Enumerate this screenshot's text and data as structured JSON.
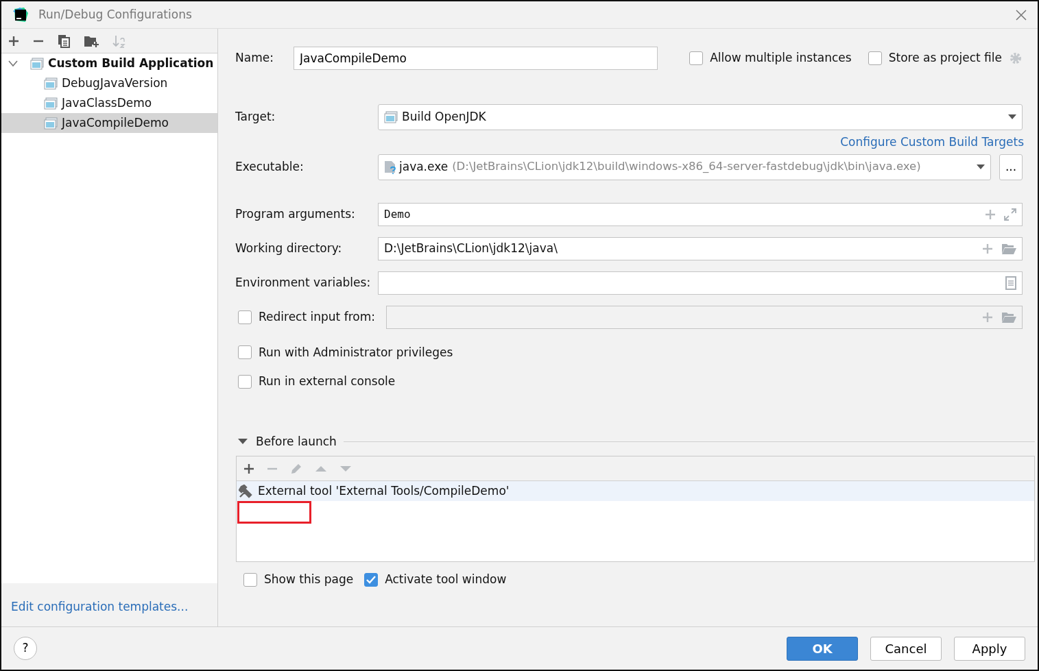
{
  "window": {
    "title": "Run/Debug Configurations"
  },
  "sidebar": {
    "toolbar": [
      {
        "kind": "add",
        "disabled": false
      },
      {
        "kind": "remove",
        "disabled": false
      },
      {
        "kind": "copy",
        "disabled": false
      },
      {
        "kind": "folder",
        "disabled": false
      },
      {
        "kind": "sort",
        "disabled": true
      }
    ],
    "tree": [
      {
        "label": "Custom Build Application",
        "expanded": true,
        "selected": false,
        "children": [
          {
            "label": "DebugJavaVersion",
            "selected": false
          },
          {
            "label": "JavaClassDemo",
            "selected": false
          },
          {
            "label": "JavaCompileDemo",
            "selected": true
          }
        ]
      }
    ],
    "templates_link": "Edit configuration templates..."
  },
  "form": {
    "name": {
      "label": "Name:",
      "value": "JavaCompileDemo"
    },
    "allow_multiple": {
      "label": "Allow multiple instances",
      "checked": false
    },
    "store_as_project": {
      "label": "Store as project file",
      "checked": false
    },
    "target": {
      "label": "Target:",
      "value": "Build OpenJDK"
    },
    "configure_link": "Configure Custom Build Targets",
    "executable": {
      "label": "Executable:",
      "value": "java.exe",
      "path": "(D:\\JetBrains\\CLion\\jdk12\\build\\windows-x86_64-server-fastdebug\\jdk\\bin\\java.exe)",
      "browse": "..."
    },
    "fields": [
      {
        "kind": "args",
        "label": "Program arguments:",
        "value": "Demo"
      },
      {
        "kind": "dir",
        "label": "Working directory:",
        "value": "D:\\JetBrains\\CLion\\jdk12\\java\\"
      },
      {
        "kind": "env",
        "label": "Environment variables:"
      }
    ],
    "redirect": {
      "label": "Redirect input from:",
      "checked": false
    },
    "options": [
      {
        "label": "Run with Administrator privileges",
        "checked": false
      },
      {
        "label": "Run in external console",
        "checked": false
      }
    ]
  },
  "before_launch": {
    "title": "Before launch",
    "expanded": true,
    "toolbar": [
      {
        "kind": "add",
        "disabled": false
      },
      {
        "kind": "remove",
        "disabled": true
      },
      {
        "kind": "edit",
        "disabled": true
      },
      {
        "kind": "up",
        "disabled": true
      },
      {
        "kind": "down",
        "disabled": true
      }
    ],
    "tasks": [
      {
        "label": "External tool 'External Tools/CompileDemo'",
        "selected": true
      }
    ],
    "show_this_page": {
      "label": "Show this page",
      "checked": false
    },
    "activate_tool_window": {
      "label": "Activate tool window",
      "checked": true
    }
  },
  "footer": {
    "help": "?",
    "buttons": [
      {
        "label": "OK",
        "kind": "default"
      },
      {
        "label": "Cancel",
        "kind": "normal"
      },
      {
        "label": "Apply",
        "kind": "normal"
      }
    ]
  }
}
